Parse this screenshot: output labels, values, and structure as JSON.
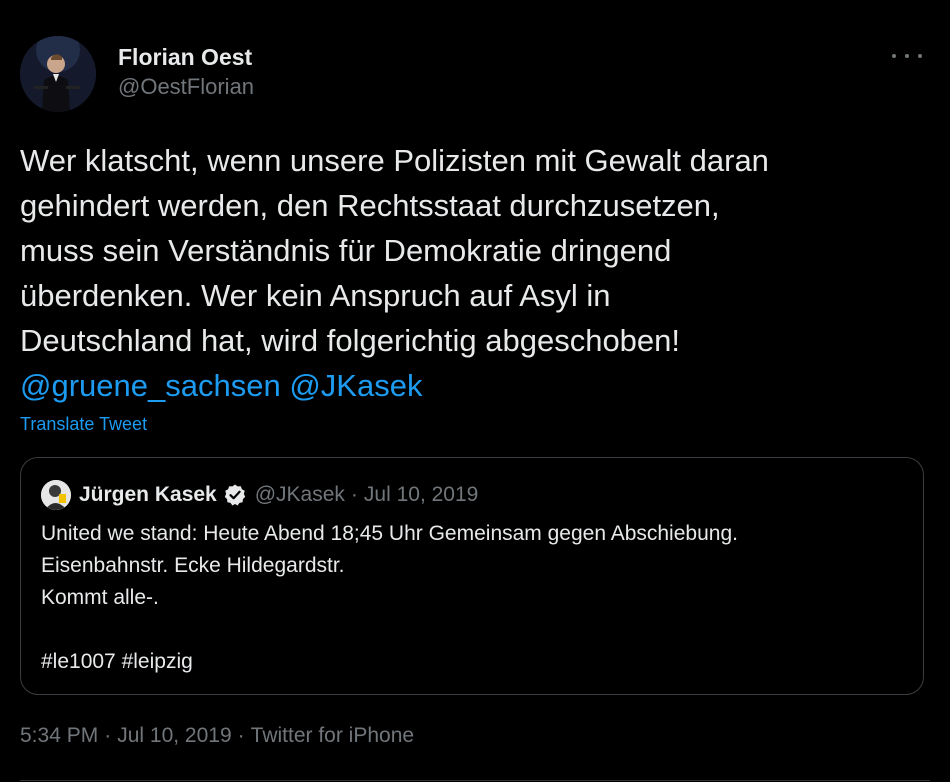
{
  "author": {
    "display_name": "Florian Oest",
    "handle": "@OestFlorian"
  },
  "tweet": {
    "lines": [
      "Wer klatscht, wenn unsere Polizisten mit Gewalt daran",
      "gehindert werden, den Rechtsstaat durchzusetzen,",
      "muss sein Verständnis für Demokratie dringend",
      "überdenken. Wer kein Anspruch auf Asyl in",
      "Deutschland hat, wird folgerichtig abgeschoben!"
    ],
    "mentions": [
      "@gruene_sachsen",
      "@JKasek"
    ],
    "translate_label": "Translate Tweet"
  },
  "quoted_tweet": {
    "display_name": "Jürgen Kasek",
    "handle": "@JKasek",
    "separator": "·",
    "date": "Jul 10, 2019",
    "lines": [
      "United we stand: Heute Abend 18;45 Uhr Gemeinsam gegen Abschiebung.",
      "Eisenbahnstr. Ecke Hildegardstr.",
      "Kommt alle-.",
      "",
      "#le1007 #leipzig"
    ]
  },
  "meta": {
    "time": "5:34 PM",
    "date": "Jul 10, 2019",
    "source": "Twitter for iPhone",
    "separator": "·"
  },
  "icons": {
    "more": "more-horizontal-icon",
    "verified": "verified-badge-icon"
  },
  "colors": {
    "background": "#000000",
    "text": "#e7e9ea",
    "secondary": "#71767b",
    "accent": "#1d9bf0",
    "border": "#3a3d41"
  }
}
